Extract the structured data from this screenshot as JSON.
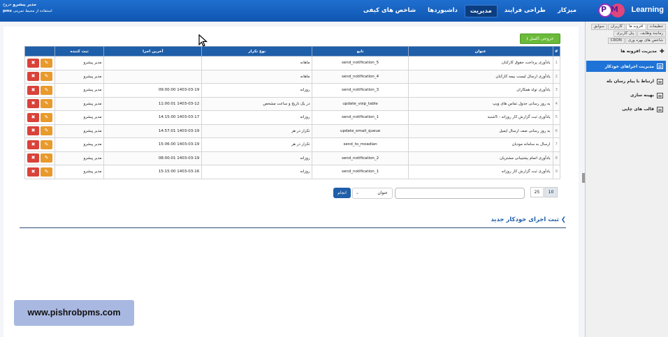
{
  "header": {
    "logo_text": "Learning",
    "logo_mark": "PM",
    "nav": [
      {
        "label": "میزکار",
        "active": false
      },
      {
        "label": "طراحی فرایند",
        "active": false
      },
      {
        "label": "مدیریت",
        "active": true
      },
      {
        "label": "داشبوردها",
        "active": false
      },
      {
        "label": "شاخص های کیفی",
        "active": false
      }
    ],
    "user": {
      "name": "مدیر پیشرو",
      "logout": "خروج",
      "line2": "استفاده از محیط تمرینی",
      "brand": "pms"
    }
  },
  "sidebar": {
    "tabs_row1": [
      "تنظیمات",
      "افزونه ها",
      "کاربران",
      "سوابق"
    ],
    "tabs_row2": [
      "زمانبند وظایف",
      "پنل کاربری"
    ],
    "tabs_row3": [
      "شاخص های بهره وری",
      "CRON"
    ],
    "menu_heading": "مدیریت افزونه ها",
    "menu": [
      {
        "label": "مدیریت اجراهای خودکار",
        "active": true
      },
      {
        "label": "ارتباط با پیام رسان بله",
        "active": false
      },
      {
        "label": "بهینه سازی",
        "active": false
      },
      {
        "label": "قالب های چاپی",
        "active": false
      }
    ]
  },
  "main": {
    "export_label": "خروجی اکسل",
    "columns": [
      "#",
      "عنوان",
      "تابع",
      "نوع تکرار",
      "آخرین اجرا",
      "ثبت کننده",
      ""
    ],
    "rows": [
      {
        "num": "1",
        "title": "یادآوری پرداخت حقوق کارکنان",
        "func": "send_notification_5",
        "repeat": "ماهانه",
        "last": "",
        "registrar": "مدیر پیشرو"
      },
      {
        "num": "2",
        "title": "یادآوری ارسال لیست بیمه کارکنان",
        "func": "send_notification_4",
        "repeat": "ماهانه",
        "last": "",
        "registrar": "مدیر پیشرو"
      },
      {
        "num": "3",
        "title": "یادآوری تولد همکاران",
        "func": "send_notification_3",
        "repeat": "روزانه",
        "last": "1403-03-19 09:00:00",
        "registrar": "مدیر پیشرو"
      },
      {
        "num": "4",
        "title": "به روز رسانی جدول تماس های ویپ",
        "func": "update_voip_table",
        "repeat": "در یک تاریخ و ساعت مشخص",
        "last": "1403-03-12 11:00:01",
        "registrar": "مدیر پیشرو"
      },
      {
        "num": "5",
        "title": "یادآوری ثبت گزارش کار روزانه - 5شنبه",
        "func": "send_notification_1",
        "repeat": "روزانه",
        "last": "1403-03-17 14:15:00",
        "registrar": "مدیر پیشرو"
      },
      {
        "num": "6",
        "title": "به روز رسانی صف ارسال ایمیل",
        "func": "update_email_queue",
        "repeat": "تکرار در هر",
        "last": "1403-03-19 14:57:01",
        "registrar": "مدیر پیشرو"
      },
      {
        "num": "7",
        "title": "ارسال به سامانه مودیان",
        "func": "send_to_moadian",
        "repeat": "تکرار در هر",
        "last": "1403-03-19 15:06:00",
        "registrar": "مدیر پیشرو"
      },
      {
        "num": "8",
        "title": "یادآوری اتمام پشتیبانی مشتریان",
        "func": "send_notification_2",
        "repeat": "روزانه",
        "last": "1403-03-19 08:00:01",
        "registrar": "مدیر پیشرو"
      },
      {
        "num": "9",
        "title": "یادآوری ثبت گزارش کار روزانه",
        "func": "send_notification_1",
        "repeat": "روزانه",
        "last": "1403-03-16 15:15:00",
        "registrar": "مدیر پیشرو"
      }
    ],
    "page_sizes": [
      "10",
      "25"
    ],
    "search_field": "عنوان",
    "search_button": "انجام",
    "new_section": "ثبت اجرای خودکار جدید"
  },
  "watermark": "www.pishrobpms.com",
  "colors": {
    "header": "#1f6fd0",
    "table_header": "#1f5ea8",
    "excel": "#6cba3a",
    "delete": "#d9423a",
    "edit": "#e89a2c",
    "side_active": "#1f73d6"
  }
}
